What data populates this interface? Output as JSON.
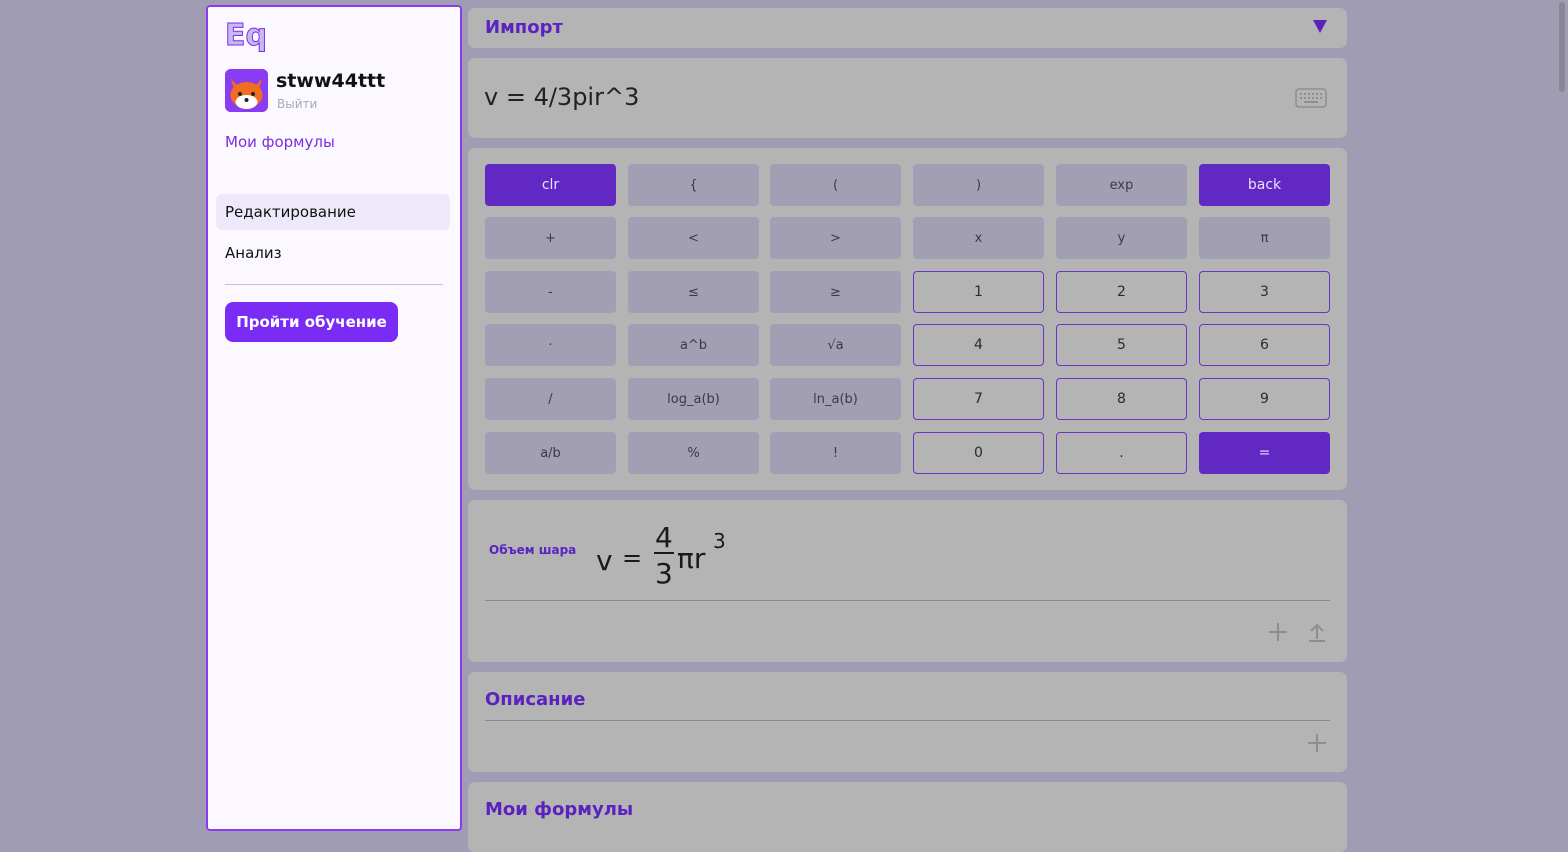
{
  "sidebar": {
    "logo_text": "Eq",
    "username": "stww44ttt",
    "logout": "Выйти",
    "my_formulas": "Мои формулы",
    "nav": [
      {
        "label": "Редактирование",
        "active": true
      },
      {
        "label": "Анализ",
        "active": false
      }
    ],
    "learn_button": "Пройти обучение"
  },
  "import": {
    "title": "Импорт",
    "icon": "triangle-down-icon"
  },
  "input": {
    "expression": "v = 4/3pir^3",
    "icon": "keyboard-icon"
  },
  "keypad": {
    "rows": [
      [
        {
          "label": "clr",
          "kind": "accent"
        },
        {
          "label": "{",
          "kind": "op"
        },
        {
          "label": "(",
          "kind": "op"
        },
        {
          "label": ")",
          "kind": "op"
        },
        {
          "label": "exp",
          "kind": "op"
        },
        {
          "label": "back",
          "kind": "accent"
        }
      ],
      [
        {
          "label": "+",
          "kind": "op"
        },
        {
          "label": "<",
          "kind": "op"
        },
        {
          "label": ">",
          "kind": "op"
        },
        {
          "label": "x",
          "kind": "op"
        },
        {
          "label": "y",
          "kind": "op"
        },
        {
          "label": "π",
          "kind": "op"
        }
      ],
      [
        {
          "label": "-",
          "kind": "op"
        },
        {
          "label": "≤",
          "kind": "op"
        },
        {
          "label": "≥",
          "kind": "op"
        },
        {
          "label": "1",
          "kind": "num"
        },
        {
          "label": "2",
          "kind": "num"
        },
        {
          "label": "3",
          "kind": "num"
        }
      ],
      [
        {
          "label": "·",
          "kind": "op"
        },
        {
          "label": "a^b",
          "kind": "op"
        },
        {
          "label": "√a",
          "kind": "op"
        },
        {
          "label": "4",
          "kind": "num"
        },
        {
          "label": "5",
          "kind": "num"
        },
        {
          "label": "6",
          "kind": "num"
        }
      ],
      [
        {
          "label": "/",
          "kind": "op"
        },
        {
          "label": "log_a(b)",
          "kind": "op"
        },
        {
          "label": "ln_a(b)",
          "kind": "op"
        },
        {
          "label": "7",
          "kind": "num"
        },
        {
          "label": "8",
          "kind": "num"
        },
        {
          "label": "9",
          "kind": "num"
        }
      ],
      [
        {
          "label": "a/b",
          "kind": "op"
        },
        {
          "label": "%",
          "kind": "op"
        },
        {
          "label": "!",
          "kind": "op"
        },
        {
          "label": "0",
          "kind": "num"
        },
        {
          "label": ".",
          "kind": "num"
        },
        {
          "label": "=",
          "kind": "accent"
        }
      ]
    ]
  },
  "result": {
    "label": "Объем шара",
    "lhs": "v",
    "eq": "=",
    "numerator": "4",
    "denominator": "3",
    "rhs": "πr",
    "exponent": "3"
  },
  "description": {
    "title": "Описание"
  },
  "my_formulas_section": {
    "title": "Мои формулы"
  },
  "colors": {
    "accent": "#7b2cf4",
    "accent_dark": "#6228c4",
    "title_purple": "#5b22c0"
  }
}
